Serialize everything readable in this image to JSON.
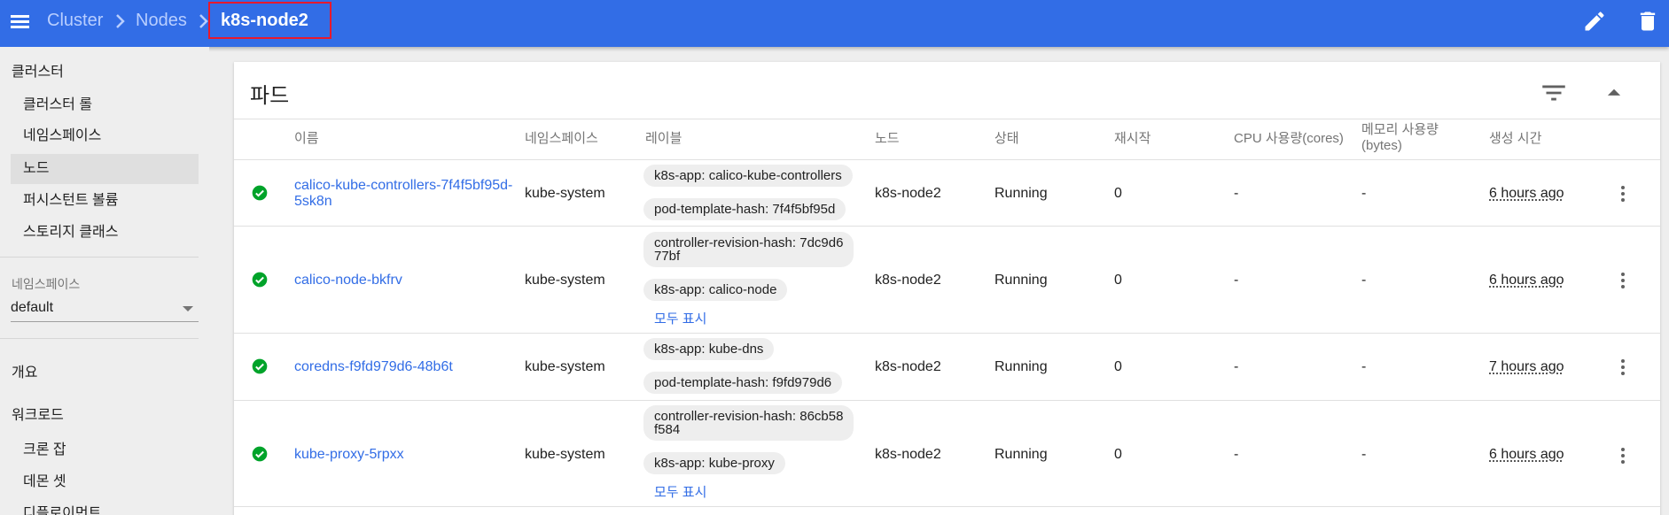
{
  "breadcrumb": {
    "cluster": "Cluster",
    "nodes": "Nodes",
    "current": "k8s-node2"
  },
  "sidebar": {
    "cluster_header": "클러스터",
    "cluster_items": [
      {
        "label": "클러스터 롤"
      },
      {
        "label": "네임스페이스"
      },
      {
        "label": "노드"
      },
      {
        "label": "퍼시스턴트 볼륨"
      },
      {
        "label": "스토리지 클래스"
      }
    ],
    "namespace_label": "네임스페이스",
    "namespace_value": "default",
    "overview": "개요",
    "workloads_header": "워크로드",
    "workload_items": [
      {
        "label": "크론 잡"
      },
      {
        "label": "데몬 셋"
      },
      {
        "label": "디플로이먼트"
      }
    ]
  },
  "card": {
    "title": "파드"
  },
  "table": {
    "headers": {
      "name": "이름",
      "namespace": "네임스페이스",
      "labels": "레이블",
      "node": "노드",
      "status": "상태",
      "restarts": "재시작",
      "cpu": "CPU 사용량(cores)",
      "memory_1": "메모리 사용량",
      "memory_2": "(bytes)",
      "created": "생성 시간"
    },
    "rows": [
      {
        "name_1": "calico-kube-controllers-7f4f5bf95d-",
        "name_2": "5sk8n",
        "namespace": "kube-system",
        "labels": [
          "k8s-app: calico-kube-controllers",
          "pod-template-hash: 7f4f5bf95d"
        ],
        "node": "k8s-node2",
        "status": "Running",
        "restarts": "0",
        "cpu": "-",
        "memory": "-",
        "age": "6 hours ago"
      },
      {
        "name_1": "calico-node-bkfrv",
        "namespace": "kube-system",
        "labels": [
          "controller-revision-hash: 7dc9d6",
          "77bf",
          "k8s-app: calico-node"
        ],
        "show_all": "모두 표시",
        "node": "k8s-node2",
        "status": "Running",
        "restarts": "0",
        "cpu": "-",
        "memory": "-",
        "age": "6 hours ago"
      },
      {
        "name_1": "coredns-f9fd979d6-48b6t",
        "namespace": "kube-system",
        "labels": [
          "k8s-app: kube-dns",
          "pod-template-hash: f9fd979d6"
        ],
        "node": "k8s-node2",
        "status": "Running",
        "restarts": "0",
        "cpu": "-",
        "memory": "-",
        "age": "7 hours ago"
      },
      {
        "name_1": "kube-proxy-5rpxx",
        "namespace": "kube-system",
        "labels": [
          "controller-revision-hash: 86cb58",
          "f584",
          "k8s-app: kube-proxy"
        ],
        "show_all": "모두 표시",
        "node": "k8s-node2",
        "status": "Running",
        "restarts": "0",
        "cpu": "-",
        "memory": "-",
        "age": "6 hours ago"
      }
    ]
  },
  "colors": {
    "primary": "#326de6",
    "success": "#00a32a",
    "highlight_border": "#e8192c"
  },
  "icons": [
    "menu-icon",
    "chevron-right-icon",
    "edit-icon",
    "delete-icon",
    "filter-icon",
    "collapse-icon",
    "check-circle-icon",
    "more-vert-icon"
  ]
}
